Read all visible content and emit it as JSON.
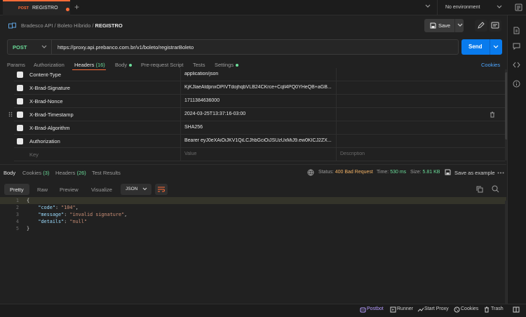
{
  "tab": {
    "method": "POST",
    "title": "REGISTRO"
  },
  "environment": {
    "label": "No environment"
  },
  "breadcrumb": {
    "items": [
      "Bradesco API",
      "Boleto Híbrido"
    ],
    "current": "REGISTRO",
    "sep": "/"
  },
  "toolbar": {
    "save_label": "Save"
  },
  "request": {
    "method": "POST",
    "url": "https://proxy.api.prebanco.com.br/v1/boleto/registrarBoleto",
    "send_label": "Send"
  },
  "request_tabs": {
    "params": "Params",
    "authorization": "Authorization",
    "headers": "Headers",
    "headers_count": "(16)",
    "body": "Body",
    "prerequest": "Pre-request Script",
    "tests": "Tests",
    "settings": "Settings",
    "cookies": "Cookies"
  },
  "headers": [
    {
      "key": "Content-Type",
      "value": "application/json"
    },
    {
      "key": "X-Brad-Signature",
      "value": "KjKJlaeAtdpnxOPIVTdojhqbVLB24CKrce+Cqll4PQ0YHeQB+aGB..."
    },
    {
      "key": "X-Brad-Nonce",
      "value": "1711384636000"
    },
    {
      "key": "X-Brad-Timestamp",
      "value": "2024-03-25T13:37:16-03:00"
    },
    {
      "key": "X-Brad-Algorithm",
      "value": "SHA256"
    },
    {
      "key": "Authorization",
      "value": "Bearer eyJ0eXAiOiJKV1QiLCJhbGciOiJSUzUxMiJ9.ew0KICJ2ZX..."
    }
  ],
  "new_header": {
    "key": "Key",
    "value": "Value",
    "description": "Description"
  },
  "response_tabs": {
    "body": "Body",
    "cookies": "Cookies",
    "cookies_count": "(3)",
    "headers": "Headers",
    "headers_count": "(26)",
    "tests": "Test Results"
  },
  "response_status": {
    "status_label": "Status:",
    "status_value": "400 Bad Request",
    "time_label": "Time:",
    "time_value": "530 ms",
    "size_label": "Size:",
    "size_value": "5.81 KB",
    "save_example": "Save as example"
  },
  "view_modes": {
    "pretty": "Pretty",
    "raw": "Raw",
    "preview": "Preview",
    "visualize": "Visualize",
    "format": "JSON"
  },
  "response_body": [
    {
      "n": "1",
      "text": "{"
    },
    {
      "n": "2",
      "key": "\"code\"",
      "value": "\"104\"",
      "trail": ","
    },
    {
      "n": "3",
      "key": "\"message\"",
      "value": "\"invalid signature\"",
      "trail": ","
    },
    {
      "n": "4",
      "key": "\"details\"",
      "value": "\"null\"",
      "trail": ""
    },
    {
      "n": "5",
      "text": "}"
    }
  ],
  "statusbar": {
    "postbot": "Postbot",
    "runner": "Runner",
    "proxy": "Start Proxy",
    "cookies": "Cookies",
    "trash": "Trash"
  },
  "colors": {
    "accent": "#ff6c37",
    "send": "#097bed",
    "success": "#6bdd9a",
    "warning": "#f2b266",
    "link": "#4ea6ff"
  }
}
